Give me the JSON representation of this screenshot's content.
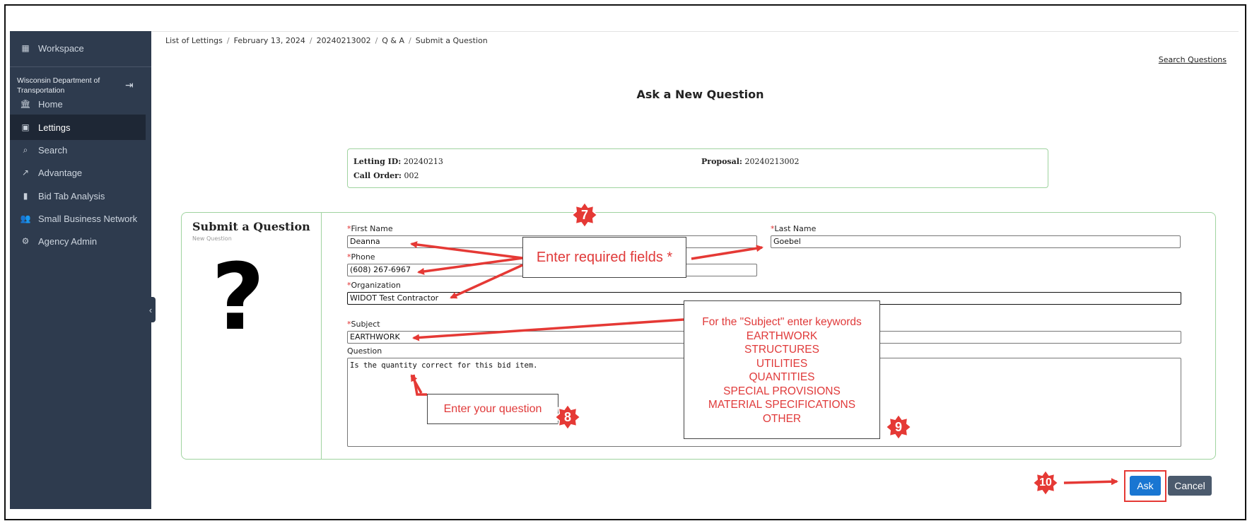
{
  "sidebar": {
    "workspace": "Workspace",
    "org_name": "Wisconsin Department of Transportation",
    "items": [
      {
        "label": "Home",
        "icon": "bank-icon"
      },
      {
        "label": "Lettings",
        "icon": "calendar-icon"
      },
      {
        "label": "Search",
        "icon": "search-icon"
      },
      {
        "label": "Advantage",
        "icon": "trend-icon"
      },
      {
        "label": "Bid Tab Analysis",
        "icon": "bar-chart-icon"
      },
      {
        "label": "Small Business Network",
        "icon": "people-icon"
      },
      {
        "label": "Agency Admin",
        "icon": "gear-icon"
      }
    ],
    "active": "Lettings"
  },
  "breadcrumb": [
    "List of Lettings",
    "February 13, 2024",
    "20240213002",
    "Q & A",
    "Submit a Question"
  ],
  "search_questions_link": "Search Questions",
  "page_title": "Ask a New Question",
  "info": {
    "letting_id_label": "Letting ID:",
    "letting_id": "20240213",
    "call_order_label": "Call Order:",
    "call_order": "002",
    "proposal_label": "Proposal:",
    "proposal": "20240213002"
  },
  "form": {
    "title": "Submit a Question",
    "subtitle": "New Question",
    "qmark": "?",
    "required_mark": "*",
    "first_name_label": "First Name",
    "first_name": "Deanna",
    "last_name_label": "Last Name",
    "last_name": "Goebel",
    "phone_label": "Phone",
    "phone": "(608) 267-6967",
    "organization_label": "Organization",
    "organization": "WIDOT Test Contractor",
    "subject_label": "Subject",
    "subject": "EARTHWORK",
    "question_label": "Question",
    "question": "Is the quantity correct for this bid item."
  },
  "annotations": {
    "required_fields": "Enter required fields *",
    "subject_keywords": [
      "For the \"Subject\" enter keywords",
      "EARTHWORK",
      "STRUCTURES",
      "UTILITIES",
      "QUANTITIES",
      "SPECIAL PROVISIONS",
      "MATERIAL SPECIFICATIONS",
      "OTHER"
    ],
    "question_hint": "Enter your question",
    "badges": [
      "7",
      "8",
      "9",
      "10"
    ],
    "color": "#e53935"
  },
  "buttons": {
    "ask": "Ask",
    "cancel": "Cancel"
  }
}
